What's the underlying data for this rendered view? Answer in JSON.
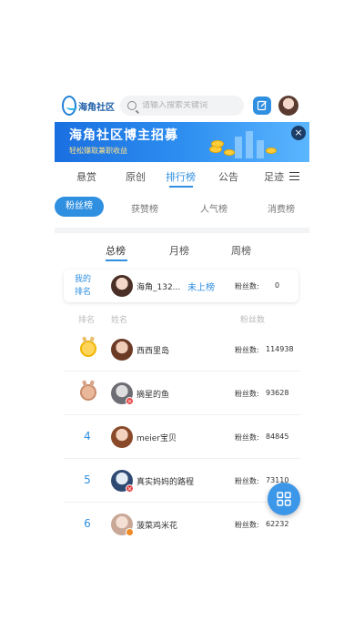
{
  "header": {
    "logo_text": "海角社区",
    "search_placeholder": "请输入搜索关键词"
  },
  "banner": {
    "title": "海角社区博主招募",
    "subtitle": "轻松赚取兼职收益",
    "close": "×"
  },
  "main_tabs": [
    "悬赏",
    "原创",
    "排行榜",
    "公告",
    "足迹"
  ],
  "rank_tabs": [
    "粉丝榜",
    "获赞榜",
    "人气榜",
    "消费榜"
  ],
  "period_tabs": [
    "总榜",
    "月榜",
    "周榜"
  ],
  "my_rank": {
    "label": "我的排名",
    "name": "海角_132...",
    "status": "未上榜",
    "fans_label": "粉丝数:",
    "fans_value": "0"
  },
  "list_header": {
    "rank": "排名",
    "name": "姓名",
    "fans": "粉丝数"
  },
  "rows": [
    {
      "rank": "1",
      "name": "西西里岛",
      "fans_label": "粉丝数:",
      "fans": "114938"
    },
    {
      "rank": "2",
      "name": "摘星的鱼",
      "fans_label": "粉丝数:",
      "fans": "93628"
    },
    {
      "rank": "4",
      "name": "meier宝贝",
      "fans_label": "粉丝数:",
      "fans": "84845"
    },
    {
      "rank": "5",
      "name": "真实妈妈的路程",
      "fans_label": "粉丝数:",
      "fans": "73110"
    },
    {
      "rank": "6",
      "name": "菠菜鸡米花",
      "fans_label": "粉丝数:",
      "fans": "62232"
    }
  ],
  "colors": {
    "accent": "#2f8fe0",
    "banner_start": "#1a6fe0",
    "banner_subtitle": "#ffe38a"
  },
  "icons": {
    "search": "search-icon",
    "edit": "edit-icon",
    "close": "close-icon",
    "menu": "menu-icon",
    "fab": "grid-icon"
  }
}
